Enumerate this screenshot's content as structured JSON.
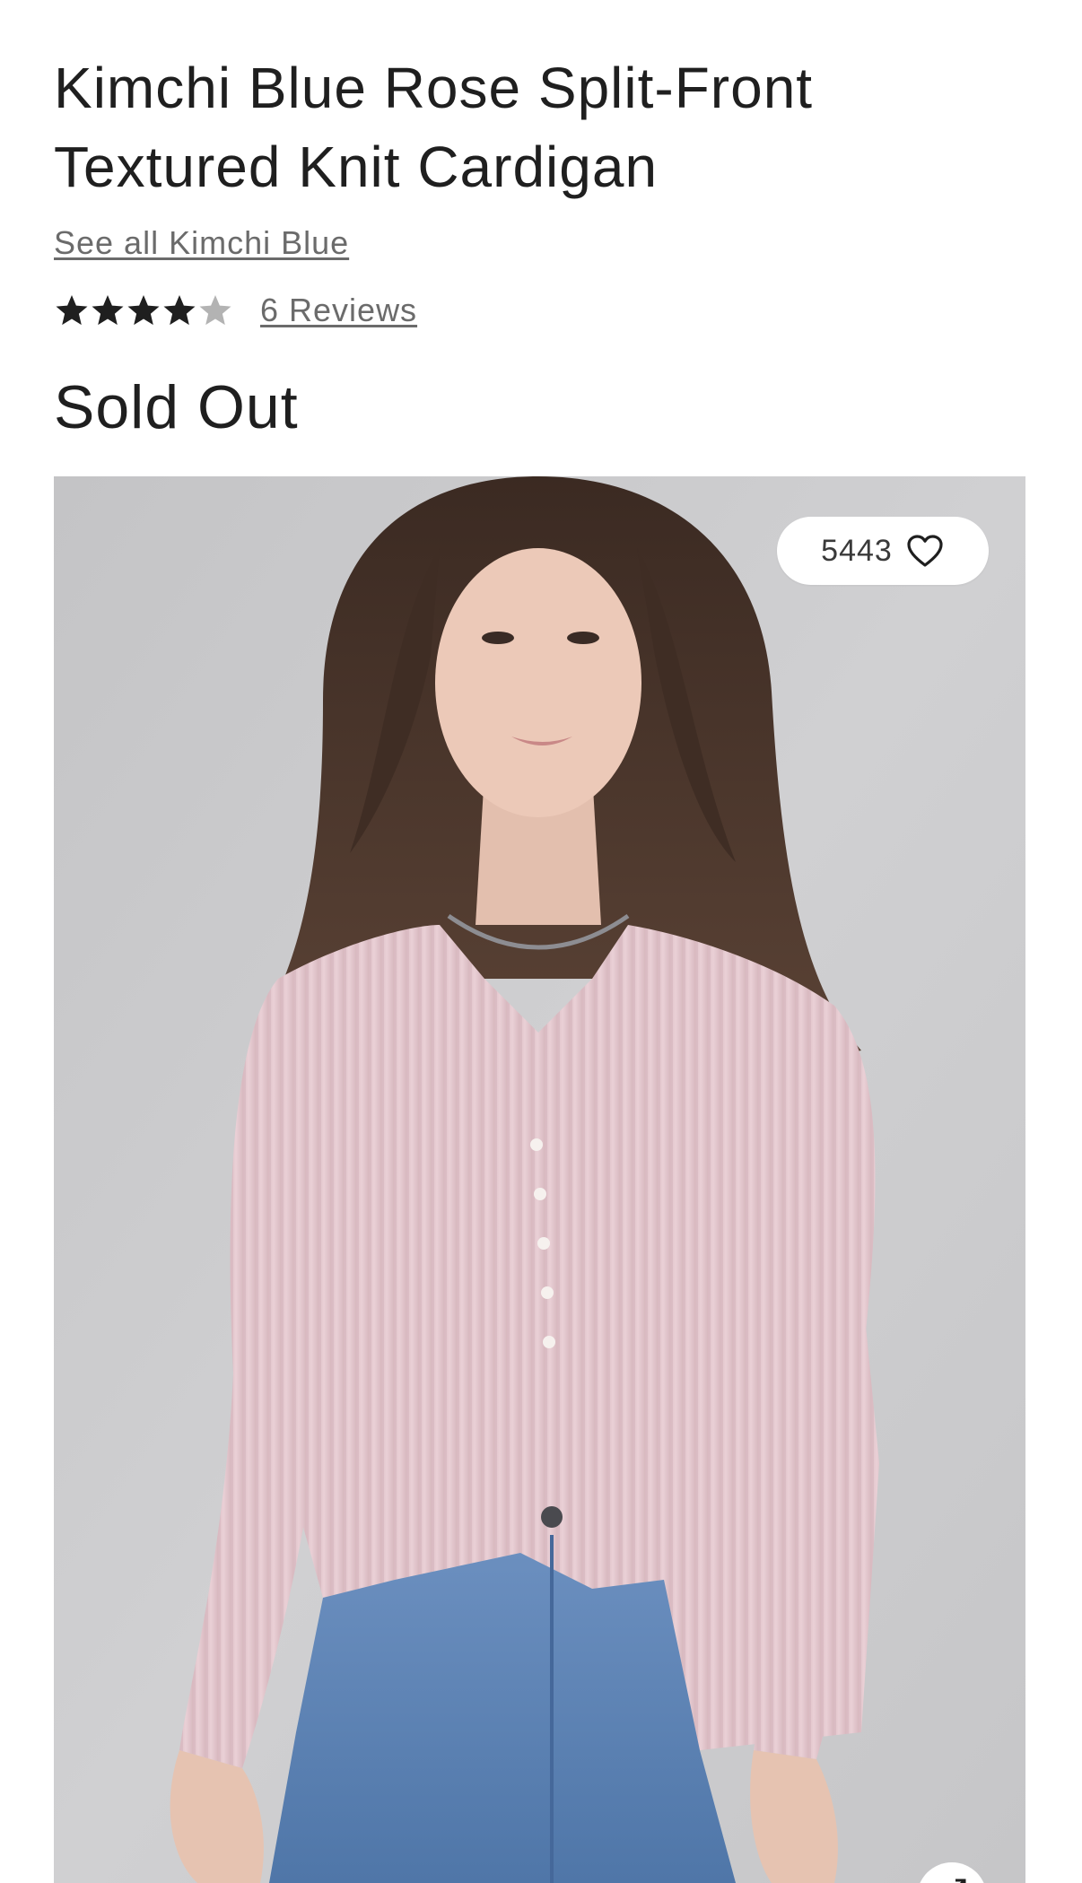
{
  "product": {
    "title": "Kimchi Blue Rose Split-Front Textured Knit Cardigan",
    "brand_link": "See all Kimchi Blue",
    "rating": 4,
    "rating_max": 5,
    "reviews_link": "6 Reviews",
    "status": "Sold Out"
  },
  "gallery": {
    "favorite_count": "5443",
    "favorite_icon": "heart-outline-icon",
    "expand_icon": "expand-arrows-icon"
  },
  "colors": {
    "text": "#1f1f1f",
    "muted_text": "#6b6b6b",
    "star_filled": "#1f1f1f",
    "star_empty": "#b3b3b3",
    "cardigan": "#e6c9cf",
    "denim": "#5f86b8",
    "backdrop": "#cbcbcd"
  }
}
